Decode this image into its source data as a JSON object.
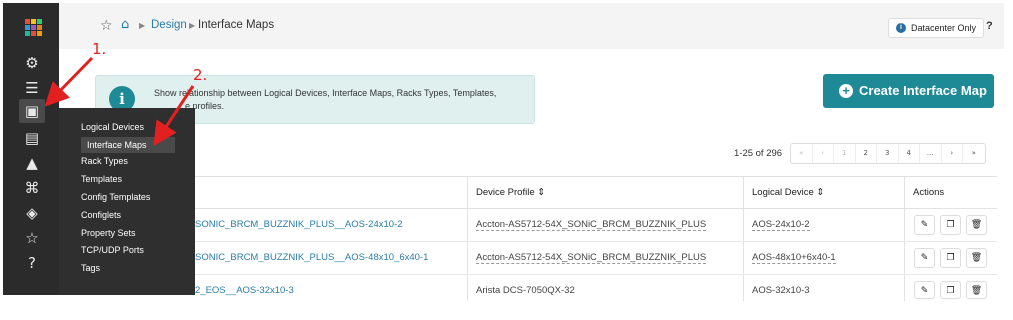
{
  "logo_colors": [
    "#e84c3d",
    "#f1c40f",
    "#2ecc71",
    "#3498db",
    "#9b59b6",
    "#e67e22",
    "#1abc9c",
    "#e74c3c",
    "#f39c12"
  ],
  "rail": {
    "icons": [
      "devices-icon",
      "servers-icon",
      "design-icon",
      "blueprints-icon",
      "analytics-icon",
      "network-icon",
      "layers-icon",
      "favorites-icon",
      "help-circle-icon"
    ]
  },
  "flyout": {
    "items": [
      {
        "label": "Logical Devices"
      },
      {
        "label": "Interface Maps"
      },
      {
        "label": "Rack Types"
      },
      {
        "label": "Templates"
      },
      {
        "label": "Config Templates"
      },
      {
        "label": "Configlets"
      },
      {
        "label": "Property Sets"
      },
      {
        "label": "TCP/UDP Ports"
      },
      {
        "label": "Tags"
      }
    ]
  },
  "breadcrumb": {
    "parent": "Design",
    "current": "Interface Maps"
  },
  "topbar": {
    "datacenter_label": "Datacenter Only",
    "help_label": "?"
  },
  "banner": {
    "line1": "Show relationship between Logical Devices, Interface Maps, Racks Types, Templates,",
    "line2": "e profiles."
  },
  "create_button": "Create Interface Map",
  "pagination": {
    "range": "1-25 of 296",
    "pages": [
      "«",
      "‹",
      "1",
      "2",
      "3",
      "4",
      "…",
      "›",
      "»"
    ]
  },
  "table": {
    "headers": {
      "device_profile": "Device Profile",
      "logical_device": "Logical Device",
      "actions": "Actions"
    },
    "rows": [
      {
        "name": "SONIC_BRCM_BUZZNIK_PLUS__AOS-24x10-2",
        "device_profile": "Accton-AS5712-54X_SONiC_BRCM_BUZZNIK_PLUS",
        "logical_device": "AOS-24x10-2"
      },
      {
        "name": "SONIC_BRCM_BUZZNIK_PLUS__AOS-48x10_6x40-1",
        "device_profile": "Accton-AS5712-54X_SONiC_BRCM_BUZZNIK_PLUS",
        "logical_device": "AOS-48x10+6x40-1"
      },
      {
        "name": "2_EOS__AOS-32x10-3",
        "device_profile": "Arista DCS-7050QX-32",
        "logical_device": "AOS-32x10-3"
      }
    ]
  },
  "annotations": {
    "step1": "1.",
    "step2": "2."
  }
}
